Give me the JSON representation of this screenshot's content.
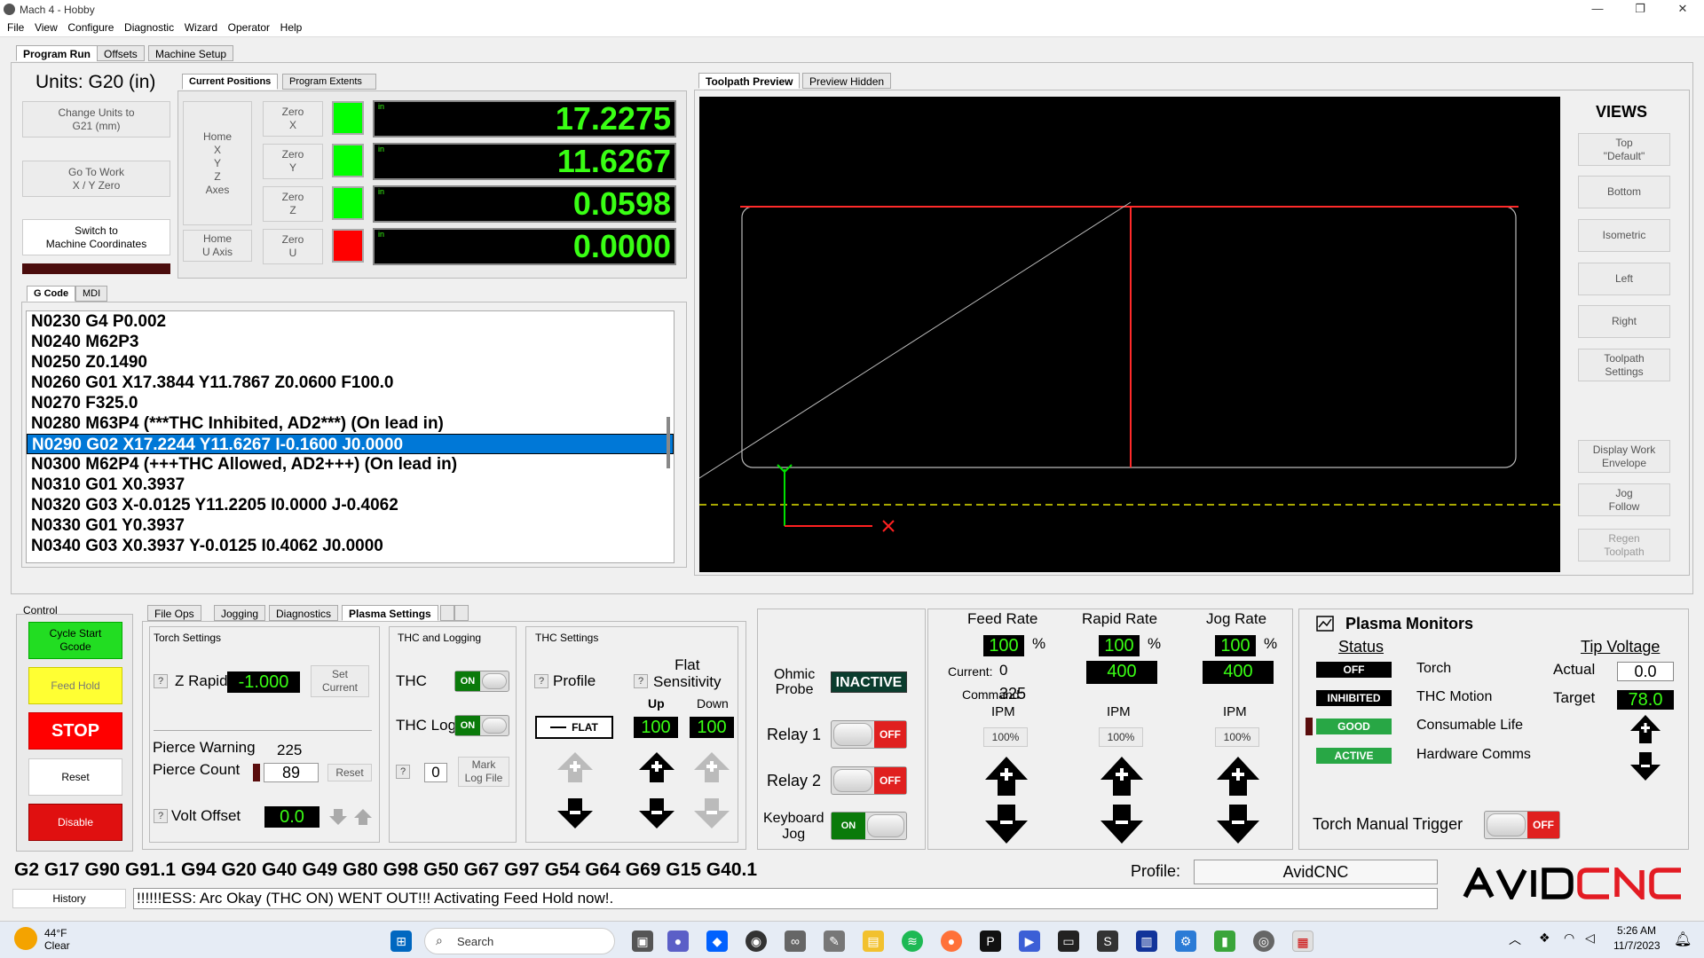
{
  "window": {
    "title": "Mach 4 - Hobby"
  },
  "menu": [
    "File",
    "View",
    "Configure",
    "Diagnostic",
    "Wizard",
    "Operator",
    "Help"
  ],
  "main_tabs": [
    "Program Run",
    "Offsets",
    "Machine Setup"
  ],
  "units": {
    "title": "Units: G20 (in)",
    "change_units": "Change Units to\nG21 (mm)",
    "goto_work": "Go To Work\nX / Y Zero",
    "switch_coords": "Switch to\nMachine Coordinates"
  },
  "positions": {
    "tabs": [
      "Current Positions",
      "Program Extents"
    ],
    "home_axes": "Home\nX\nY\nZ\nAxes",
    "home_u": "Home\nU  Axis",
    "unit": "in",
    "rows": [
      {
        "zero": "Zero\nX",
        "value": "17.2275",
        "lamp": "#00ff00"
      },
      {
        "zero": "Zero\nY",
        "value": "11.6267",
        "lamp": "#00ff00"
      },
      {
        "zero": "Zero\nZ",
        "value": "0.0598",
        "lamp": "#00ff00"
      },
      {
        "zero": "Zero\nU",
        "value": "0.0000",
        "lamp": "#ff0000"
      }
    ]
  },
  "gcode": {
    "tabs": [
      "G Code",
      "MDI"
    ],
    "lines": [
      "N0230 G4 P0.002",
      "N0240 M62P3",
      "N0250 Z0.1490",
      "N0260 G01 X17.3844 Y11.7867 Z0.0600 F100.0",
      "N0270 F325.0",
      "N0280 M63P4 (***THC Inhibited, AD2***) (On lead in)",
      "N0290 G02 X17.2244 Y11.6267 I-0.1600 J0.0000",
      "N0300 M62P4 (+++THC Allowed, AD2+++) (On lead in)",
      "N0310 G01 X0.3937",
      "N0320 G03 X-0.0125 Y11.2205 I0.0000 J-0.4062",
      "N0330 G01 Y0.3937",
      "N0340 G03 X0.3937 Y-0.0125 I0.4062 J0.0000"
    ],
    "selected_index": 6
  },
  "toolpath": {
    "tabs": [
      "Toolpath Preview",
      "Preview Hidden"
    ],
    "views_title": "VIEWS",
    "views": [
      "Top\n\"Default\"",
      "Bottom",
      "Isometric",
      "Left",
      "Right",
      "Toolpath\nSettings"
    ],
    "extra": [
      "Display Work\nEnvelope",
      "Jog\nFollow",
      "Regen\nToolpath"
    ]
  },
  "control": {
    "title": "Control",
    "cycle_start": "Cycle Start\nGcode",
    "feed_hold": "Feed Hold",
    "stop": "STOP",
    "reset": "Reset",
    "disable": "Disable"
  },
  "plasma_tabs": [
    "File Ops",
    "Jogging",
    "Diagnostics",
    "Plasma Settings"
  ],
  "torch_settings": {
    "title": "Torch Settings",
    "z_rapid_label": "Z Rapid",
    "z_rapid": "-1.000",
    "set_current": "Set\nCurrent",
    "pierce_warning_label": "Pierce Warning",
    "pierce_warning": "225",
    "pierce_count_label": "Pierce Count",
    "pierce_count": "89",
    "reset": "Reset",
    "volt_offset_label": "Volt Offset",
    "volt_offset": "0.0"
  },
  "thc_logging": {
    "title": "THC and Logging",
    "thc": "THC",
    "thc_log": "THC Log",
    "on": "ON",
    "log_value": "0",
    "mark_log": "Mark\nLog File"
  },
  "thc_settings": {
    "title": "THC Settings",
    "profile": "Profile",
    "flat_sensitivity": "Flat\nSensitivity",
    "flat_btn": "FLAT",
    "up": "Up",
    "down": "Down",
    "up_value": "100",
    "down_value": "100"
  },
  "relays": {
    "ohmic_probe": "Ohmic\nProbe",
    "ohmic_status": "INACTIVE",
    "relay1": "Relay 1",
    "relay2": "Relay 2",
    "keyboard_jog": "Keyboard\nJog",
    "off": "OFF",
    "on": "ON"
  },
  "rates": {
    "feed": {
      "title": "Feed Rate",
      "pct": "100",
      "current_label": "Current:",
      "current": "0",
      "command_label": "Command:",
      "command": "325",
      "ipm": "IPM",
      "btn": "100%"
    },
    "rapid": {
      "title": "Rapid Rate",
      "pct": "100",
      "value": "400",
      "ipm": "IPM",
      "btn": "100%"
    },
    "jog": {
      "title": "Jog Rate",
      "pct": "100",
      "value": "400",
      "ipm": "IPM",
      "btn": "100%"
    },
    "percent_sign": "%"
  },
  "plasma_monitors": {
    "title": "Plasma Monitors",
    "status_header": "Status",
    "items": [
      {
        "status": "OFF",
        "label": "Torch",
        "bg": "#000000",
        "fg": "#ffffff"
      },
      {
        "status": "INHIBITED",
        "label": "THC Motion",
        "bg": "#000000",
        "fg": "#ffffff"
      },
      {
        "status": "GOOD",
        "label": "Consumable Life",
        "bg": "#28a745",
        "fg": "#ffffff"
      },
      {
        "status": "ACTIVE",
        "label": "Hardware Comms",
        "bg": "#28a745",
        "fg": "#ffffff"
      }
    ],
    "tip_voltage": "Tip Voltage",
    "actual_label": "Actual",
    "actual": "0.0",
    "target_label": "Target",
    "target": "78.0",
    "torch_manual": "Torch Manual Trigger",
    "off": "OFF"
  },
  "modal": "G2 G17 G90 G91.1 G94 G20 G40 G49 G80 G98 G50 G67 G97 G54 G64 G69 G15 G40.1",
  "profile": {
    "label": "Profile:",
    "value": "AvidCNC"
  },
  "history": "History",
  "message": "!!!!!!ESS: Arc Okay (THC ON) WENT OUT!!! Activating Feed Hold now!.",
  "brand": "AVIDCNC",
  "taskbar": {
    "weather_temp": "44°F",
    "weather_desc": "Clear",
    "search": "Search",
    "time": "5:26 AM",
    "date": "11/7/2023"
  },
  "colors": {
    "dro_green": "#39ff14",
    "selection": "#0078d7",
    "stop_red": "#ff0000",
    "cycle_green": "#22dd22",
    "feedhold_yellow": "#ffff33"
  }
}
